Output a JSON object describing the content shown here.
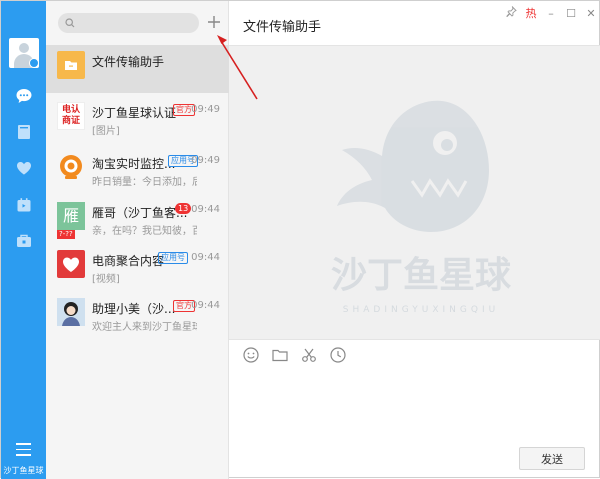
{
  "sidebar": {
    "footer_text": "沙丁鱼星球",
    "icons": [
      "chat-icon",
      "contacts-book-icon",
      "heart-icon",
      "calendar-icon",
      "apps-icon",
      "menu-icon"
    ]
  },
  "search": {
    "placeholder": ""
  },
  "conversations": [
    {
      "name": "文件传输助手",
      "preview": "",
      "time": "",
      "tag": "",
      "active": true
    },
    {
      "name": "沙丁鱼星球认证",
      "preview": "[图片]",
      "time": "09:49",
      "tag": "官方"
    },
    {
      "name": "淘宝实时监控...",
      "preview": "昨日销量：今日添加，后天...",
      "time": "09:49",
      "tag": "应用号"
    },
    {
      "name": "雁哥（沙丁鱼客...",
      "preview": "亲，在吗？我已知彼，百战...",
      "time": "09:44",
      "tag": "",
      "badge": "13",
      "mini_flag": "?-??"
    },
    {
      "name": "电商聚合内容",
      "preview": "[视频]",
      "time": "09:44",
      "tag": "应用号"
    },
    {
      "name": "助理小美（沙...",
      "preview": "欢迎主人来到沙丁鱼星球",
      "time": "09:44",
      "tag": "官方"
    }
  ],
  "thumb_labels": {
    "cert_line1": "电认",
    "cert_line2": "商证",
    "yan": "雁"
  },
  "chat": {
    "title": "文件传输助手",
    "window_hot_label": "热",
    "send_label": "发送",
    "watermark_text": "沙丁鱼星球",
    "watermark_pinyin": "SHADINGYUXINGQIU"
  },
  "colors": {
    "accent": "#2c9cf0",
    "red": "#e33333",
    "orange": "#f7b84b"
  }
}
